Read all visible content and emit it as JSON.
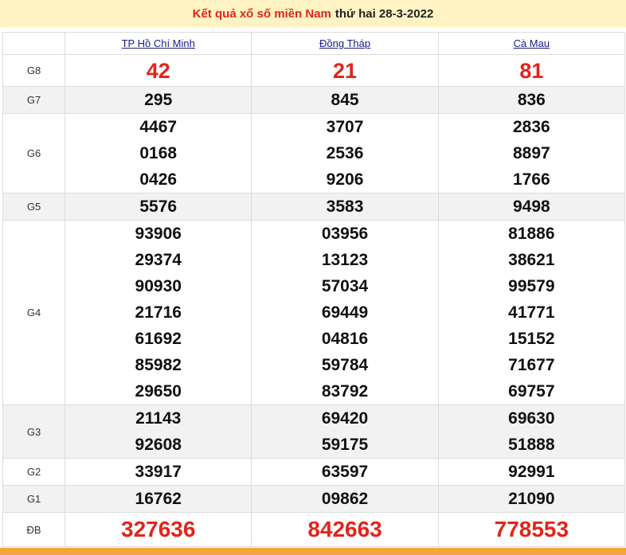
{
  "header": {
    "title_link": "Kết quả xổ số miền Nam",
    "date_text": "thứ hai 28-3-2022"
  },
  "provinces": [
    "TP Hồ Chí Minh",
    "Đồng Tháp",
    "Cà Mau"
  ],
  "prizes": [
    {
      "label": "G8",
      "values": [
        [
          "42"
        ],
        [
          "21"
        ],
        [
          "81"
        ]
      ]
    },
    {
      "label": "G7",
      "values": [
        [
          "295"
        ],
        [
          "845"
        ],
        [
          "836"
        ]
      ]
    },
    {
      "label": "G6",
      "values": [
        [
          "4467",
          "0168",
          "0426"
        ],
        [
          "3707",
          "2536",
          "9206"
        ],
        [
          "2836",
          "8897",
          "1766"
        ]
      ]
    },
    {
      "label": "G5",
      "values": [
        [
          "5576"
        ],
        [
          "3583"
        ],
        [
          "9498"
        ]
      ]
    },
    {
      "label": "G4",
      "values": [
        [
          "93906",
          "29374",
          "90930",
          "21716",
          "61692",
          "85982",
          "29650"
        ],
        [
          "03956",
          "13123",
          "57034",
          "69449",
          "04816",
          "59784",
          "83792"
        ],
        [
          "81886",
          "38621",
          "99579",
          "41771",
          "15152",
          "71677",
          "69757"
        ]
      ]
    },
    {
      "label": "G3",
      "values": [
        [
          "21143",
          "92608"
        ],
        [
          "69420",
          "59175"
        ],
        [
          "69630",
          "51888"
        ]
      ]
    },
    {
      "label": "G2",
      "values": [
        [
          "33917"
        ],
        [
          "63597"
        ],
        [
          "92991"
        ]
      ]
    },
    {
      "label": "G1",
      "values": [
        [
          "16762"
        ],
        [
          "09862"
        ],
        [
          "21090"
        ]
      ]
    },
    {
      "label": "ĐB",
      "values": [
        [
          "327636"
        ],
        [
          "842663"
        ],
        [
          "778553"
        ]
      ]
    }
  ],
  "colors": {
    "accent_red": "#e1251b",
    "header_bg": "#fff3c4",
    "link_blue": "#1a1a8c"
  }
}
